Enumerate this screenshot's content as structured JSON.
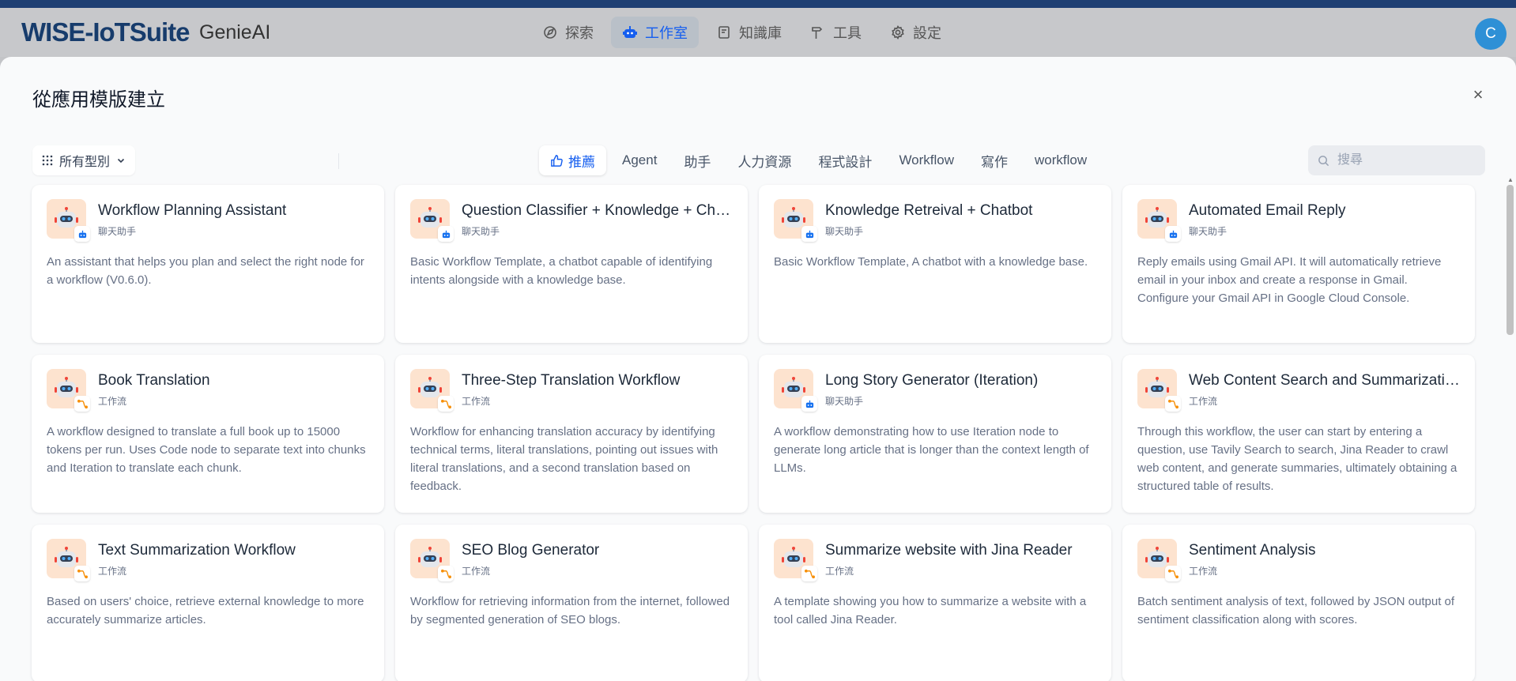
{
  "header": {
    "brand": "WISE-IoTSuite",
    "brand_sub": "GenieAI",
    "nav": [
      {
        "label": "探索",
        "icon": "compass-icon",
        "active": false
      },
      {
        "label": "工作室",
        "icon": "robot-icon",
        "active": true
      },
      {
        "label": "知識庫",
        "icon": "book-icon",
        "active": false
      },
      {
        "label": "工具",
        "icon": "tools-icon",
        "active": false
      },
      {
        "label": "設定",
        "icon": "gear-icon",
        "active": false
      }
    ],
    "avatar_initial": "C"
  },
  "modal": {
    "title": "從應用模版建立",
    "close": "×",
    "category_select": "所有型別",
    "tabs": [
      {
        "label": "推薦",
        "active": true
      },
      {
        "label": "Agent",
        "active": false
      },
      {
        "label": "助手",
        "active": false
      },
      {
        "label": "人力資源",
        "active": false
      },
      {
        "label": "程式設計",
        "active": false
      },
      {
        "label": "Workflow",
        "active": false
      },
      {
        "label": "寫作",
        "active": false
      },
      {
        "label": "workflow",
        "active": false
      }
    ],
    "search_placeholder": "搜尋",
    "cards": [
      {
        "title": "Workflow Planning Assistant",
        "type": "聊天助手",
        "kind": "chat",
        "desc": "An assistant that helps you plan and select the right node for a workflow (V0.6.0)."
      },
      {
        "title": "Question Classifier + Knowledge + Chatbot",
        "type": "聊天助手",
        "kind": "chat",
        "desc": "Basic Workflow Template, a chatbot capable of identifying intents alongside with a knowledge base."
      },
      {
        "title": "Knowledge Retreival + Chatbot",
        "type": "聊天助手",
        "kind": "chat",
        "desc": "Basic Workflow Template, A chatbot with a knowledge base."
      },
      {
        "title": "Automated Email Reply",
        "type": "聊天助手",
        "kind": "chat",
        "desc": "Reply emails using Gmail API. It will automatically retrieve email in your inbox and create a response in Gmail. Configure your Gmail API in Google Cloud Console."
      },
      {
        "title": "Book Translation",
        "type": "工作流",
        "kind": "workflow",
        "desc": "A workflow designed to translate a full book up to 15000 tokens per run. Uses Code node to separate text into chunks and Iteration to translate each chunk."
      },
      {
        "title": "Three-Step Translation Workflow",
        "type": "工作流",
        "kind": "workflow",
        "desc": "Workflow for enhancing translation accuracy by identifying technical terms, literal translations, pointing out issues with literal translations, and a second translation based on feedback."
      },
      {
        "title": "Long Story Generator (Iteration)",
        "type": "聊天助手",
        "kind": "chat",
        "desc": "A workflow demonstrating how to use Iteration node to generate long article that is longer than the context length of LLMs."
      },
      {
        "title": "Web Content Search and Summarization Workflow",
        "type": "工作流",
        "kind": "workflow",
        "desc": "Through this workflow, the user can start by entering a question, use Tavily Search to search, Jina Reader to crawl web content, and generate summaries, ultimately obtaining a structured table of results."
      },
      {
        "title": "Text Summarization Workflow",
        "type": "工作流",
        "kind": "workflow",
        "desc": "Based on users' choice, retrieve external knowledge to more accurately summarize articles."
      },
      {
        "title": "SEO Blog Generator",
        "type": "工作流",
        "kind": "workflow",
        "desc": "Workflow for retrieving information from the internet, followed by segmented generation of SEO blogs."
      },
      {
        "title": "Summarize website with Jina Reader",
        "type": "工作流",
        "kind": "workflow",
        "desc": "A template showing you how to summarize a website with a tool called Jina Reader."
      },
      {
        "title": "Sentiment Analysis",
        "type": "工作流",
        "kind": "workflow",
        "desc": "Batch sentiment analysis of text, followed by JSON output of sentiment classification along with scores."
      }
    ]
  },
  "colors": {
    "accent": "#155eef",
    "brand": "#173c6c",
    "chat_badge": "#1570ef",
    "workflow_badge": "#f79009"
  }
}
